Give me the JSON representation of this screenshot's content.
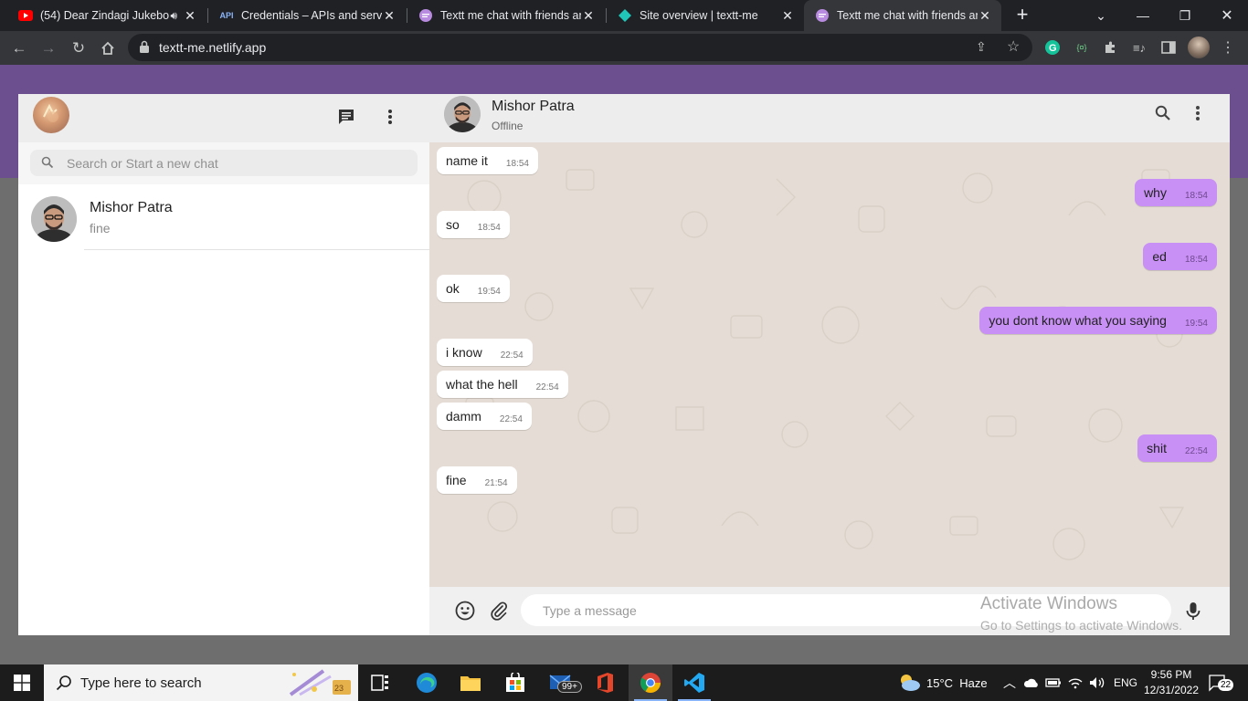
{
  "browser": {
    "tabs": [
      {
        "title": "(54) Dear Zindagi Jukebo",
        "icon": "youtube-icon",
        "audio": true,
        "active": false
      },
      {
        "title": "Credentials – APIs and servic",
        "icon": "api-icon",
        "active": false
      },
      {
        "title": "Textt me chat with friends an",
        "icon": "chat-icon",
        "active": false
      },
      {
        "title": "Site overview | textt-me",
        "icon": "netlify-icon",
        "active": false
      },
      {
        "title": "Textt me chat with friends an",
        "icon": "chat-icon",
        "active": true
      }
    ],
    "api_badge": "API",
    "url": "textt-me.netlify.app"
  },
  "sidebar": {
    "search_placeholder": "Search or Start a new chat",
    "contacts": [
      {
        "name": "Mishor Patra",
        "last_message": "fine"
      }
    ]
  },
  "chat": {
    "contact_name": "Mishor Patra",
    "status": "Offline",
    "messages": [
      {
        "text": "name it",
        "time": "18:54",
        "dir": "in"
      },
      {
        "text": "why",
        "time": "18:54",
        "dir": "out"
      },
      {
        "text": "so",
        "time": "18:54",
        "dir": "in"
      },
      {
        "text": "ed",
        "time": "18:54",
        "dir": "out"
      },
      {
        "text": "ok",
        "time": "19:54",
        "dir": "in"
      },
      {
        "text": "you dont know what you saying",
        "time": "19:54",
        "dir": "out"
      },
      {
        "text": "i know",
        "time": "22:54",
        "dir": "in"
      },
      {
        "text": "what the hell",
        "time": "22:54",
        "dir": "in"
      },
      {
        "text": "damm",
        "time": "22:54",
        "dir": "in"
      },
      {
        "text": "shit",
        "time": "22:54",
        "dir": "out"
      },
      {
        "text": "fine",
        "time": "21:54",
        "dir": "in"
      }
    ],
    "input_placeholder": "Type a message"
  },
  "watermark": {
    "line1": "Activate Windows",
    "line2": "Go to Settings to activate Windows."
  },
  "taskbar": {
    "search_text": "Type here to search",
    "mail_badge": "99+",
    "weather": "15°C  Haze",
    "language": "ENG",
    "time": "9:56 PM",
    "date": "12/31/2022",
    "notifications": "22"
  },
  "colors": {
    "purple_bar": "#6b4f8f",
    "outgoing_bubble": "#c88ff5",
    "chat_background": "#e5ddd5"
  }
}
